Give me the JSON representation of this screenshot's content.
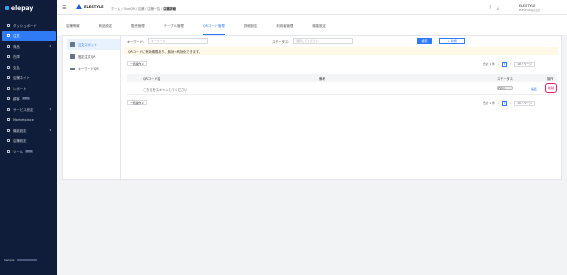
{
  "brand": {
    "name": "elepay"
  },
  "sidebar": {
    "items": [
      {
        "label": "ダッシュボード"
      },
      {
        "label": "注文"
      },
      {
        "label": "商品"
      },
      {
        "label": "在庫"
      },
      {
        "label": "支払"
      },
      {
        "label": "店舗ネイト"
      },
      {
        "label": "レポート"
      },
      {
        "label": "顧客",
        "badge": "NEW"
      },
      {
        "label": "サービス設定"
      },
      {
        "label": "Marketplace"
      },
      {
        "label": "機能設定"
      },
      {
        "label": "店舗設定"
      },
      {
        "label": "ツール",
        "badge": "NEW"
      }
    ],
    "footer": "Sample"
  },
  "topbar": {
    "store": "ELESTYLE",
    "crumbs": [
      "ホーム",
      "OneQR",
      "店舗",
      "店舗一覧"
    ],
    "crumb_current": "店舗詳細",
    "user_name": "ELESTYLE",
    "user_email": "ELESTYLE株式会社"
  },
  "tabs": [
    "店舗情報",
    "商品設定",
    "販売管理",
    "テーブル管理",
    "QRコード管理",
    "詳細設定",
    "利用者管理",
    "機能設定"
  ],
  "subnav": [
    {
      "label": "注文スポット"
    },
    {
      "label": "固定注文QR"
    },
    {
      "label": "キーワードQR"
    }
  ],
  "search": {
    "keyword_label": "キーワード：",
    "keyword_placeholder": "キーワード",
    "status_label": "ステータス：",
    "status_placeholder": "選択してください",
    "search_button": "検索",
    "add_button": "+ 新規"
  },
  "notice": "QRコードに有効期限あり、無効→有効化できます。",
  "batch_label": "一括操作",
  "pagination": {
    "total": "合計 1 件",
    "page": "1",
    "per_page": "10 / ページ"
  },
  "table": {
    "headers": [
      "QRコード名",
      "備考",
      "ステータス",
      "操作"
    ],
    "rows": [
      {
        "name": "こちらをスキャンしてください",
        "note": "",
        "status": "無効",
        "edit": "編集",
        "delete": "削除"
      }
    ]
  }
}
